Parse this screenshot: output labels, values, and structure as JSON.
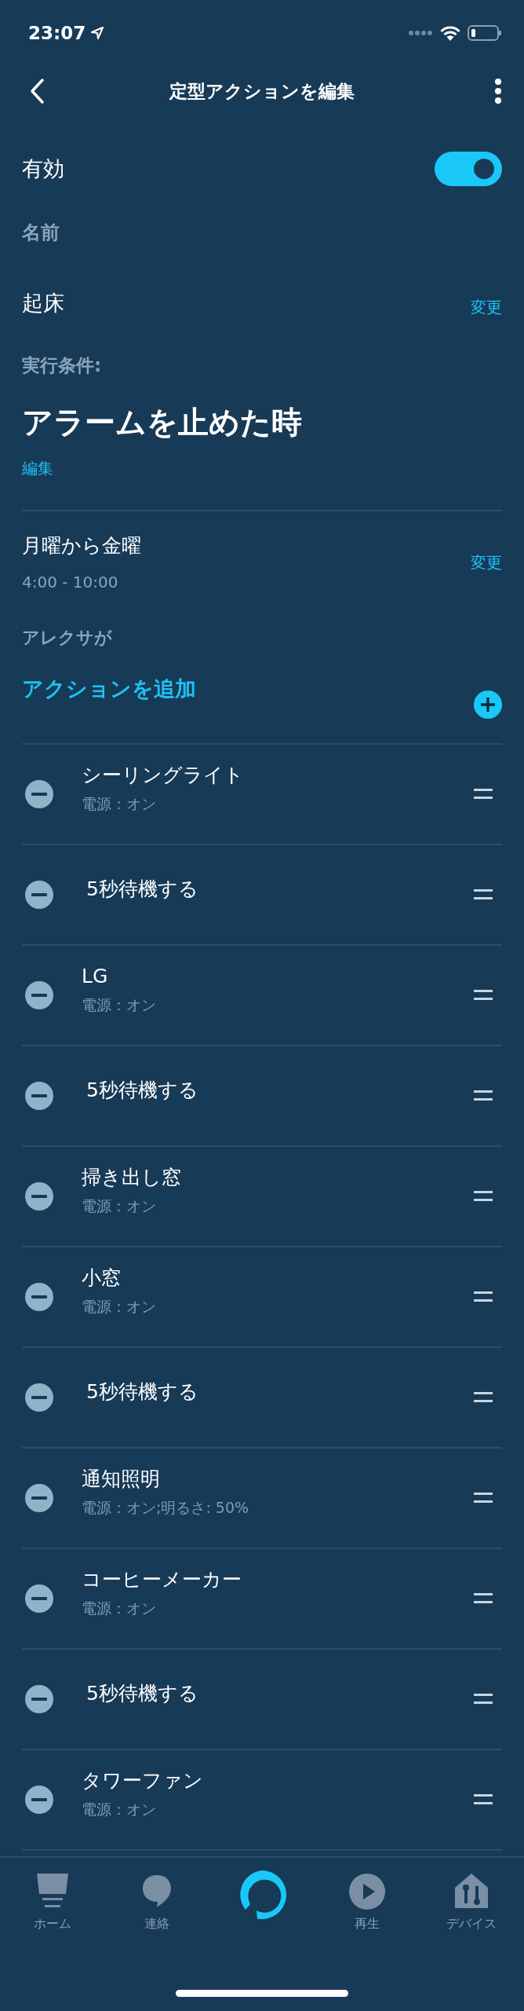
{
  "status_bar": {
    "time": "23:07"
  },
  "header": {
    "title": "定型アクションを編集"
  },
  "enabled": {
    "label": "有効",
    "on": true
  },
  "name": {
    "label": "名前",
    "value": "起床",
    "change_link": "変更"
  },
  "trigger": {
    "label": "実行条件:",
    "title": "アラームを止めた時",
    "edit_link": "編集"
  },
  "schedule": {
    "days": "月曜から金曜",
    "time_range": "4:00 - 10:00",
    "change_link": "変更"
  },
  "actions": {
    "label": "アレクサが",
    "add_label": "アクションを追加",
    "items": [
      {
        "kind": "device",
        "title": "シーリングライト",
        "detail": "電源：オン"
      },
      {
        "kind": "wait",
        "title": "5秒待機する"
      },
      {
        "kind": "device",
        "title": "LG",
        "detail": "電源：オン"
      },
      {
        "kind": "wait",
        "title": "5秒待機する"
      },
      {
        "kind": "device",
        "title": "掃き出し窓",
        "detail": "電源：オン"
      },
      {
        "kind": "device",
        "title": "小窓",
        "detail": "電源：オン"
      },
      {
        "kind": "wait",
        "title": "5秒待機する"
      },
      {
        "kind": "device",
        "title": "通知照明",
        "detail": "電源：オン;明るさ: 50%"
      },
      {
        "kind": "device",
        "title": "コーヒーメーカー",
        "detail": "電源：オン"
      },
      {
        "kind": "wait",
        "title": "5秒待機する"
      },
      {
        "kind": "device",
        "title": "タワーファン",
        "detail": "電源：オン"
      }
    ]
  },
  "tab_bar": [
    {
      "kind": "home",
      "label": "ホーム"
    },
    {
      "kind": "chat",
      "label": "連絡"
    },
    {
      "kind": "alexa"
    },
    {
      "kind": "play",
      "label": "再生"
    },
    {
      "kind": "devices",
      "label": "デバイス"
    }
  ]
}
